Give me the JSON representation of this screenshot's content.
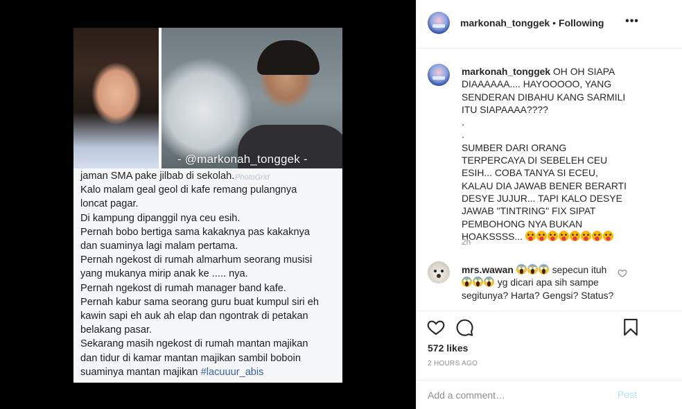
{
  "post": {
    "watermark": "- @markonah_tonggek -",
    "watermark_small": "PhotoGrid",
    "image_text_lines": [
      "jaman SMA pake jilbab di sekolah.",
      "Kalo malam geal geol di kafe remang pulangnya",
      "loncat pagar.",
      "Di kampung dipanggil nya ceu esih.",
      "Pernah bobo bertiga sama kakaknya pas kakaknya",
      "dan suaminya lagi malam pertama.",
      "Pernah ngekost di rumah almarhum seorang musisi",
      "yang mukanya mirip anak ke ..... nya.",
      "Pernah ngekost di rumah manager band kafe.",
      "Pernah kabur sama seorang guru buat kumpul siri eh",
      "kawin sapi eh auk ah elap dan ngontrak di petakan",
      "belakang pasar.",
      "Sekarang masih ngekost di rumah mantan majikan",
      "dan tidur di kamar mantan majikan sambil boboin"
    ],
    "image_text_last_prefix": "suaminya mantan majikan ",
    "image_text_hashtag": "#lacuuur_abis"
  },
  "header": {
    "username": "markonah_tonggek",
    "separator": "•",
    "follow_status": "Following",
    "more_icon": "more-horizontal-icon",
    "more_label": "•••"
  },
  "caption": {
    "username": "markonah_tonggek",
    "text_first": "OH OH SIAPA DIAAAAAA.... HAYOOOOO, YANG SENDERAN DIBAHU KANG SARMILI ITU SIAPAAAA????",
    "dot1": ".",
    "dot2": ".",
    "text_second": "SUMBER DARI ORANG TERPERCAYA DI SEBELEH CEU ESIH... COBA TANYA SI ECEU, KALAU DIA JAWAB BENER BERARTI DESYE JUJUR... TAPI KALO DESYE JAWAB \"TINTRING\" FIX SIPAT PEMBOHONG NYA BUKAN HOAKSSSS...",
    "emoji_count": 8,
    "emoji_name": "face-with-tongue-emoji",
    "time": "2h"
  },
  "comment": {
    "username": "mrs.wawan",
    "text_a": "sepecun ituh",
    "text_b": "yg dicari apa sih sampe segitunya? Harta? Gengsi? Status?",
    "emoji_name": "screaming-face-emoji"
  },
  "actions": {
    "likes": "572 likes",
    "age": "2 HOURS AGO"
  },
  "add_comment": {
    "placeholder": "Add a comment…",
    "post_label": "Post"
  },
  "colors": {
    "background": "#000000",
    "panel": "#ffffff",
    "border": "#efefef",
    "text": "#262626",
    "muted": "#8e8e8e",
    "post_disabled": "#b2dffc",
    "hashtag": "#3a5ea8"
  }
}
